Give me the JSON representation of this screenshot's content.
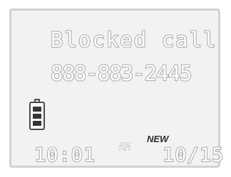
{
  "display": {
    "status_line": "Blocked call",
    "phone_number": "888-883-2445",
    "badge": "NEW",
    "time": "10:01",
    "am_pm": "AM",
    "date": "10/15"
  },
  "battery": {
    "level_bars": 3,
    "max_bars": 3,
    "icon": "battery-icon"
  },
  "colors": {
    "screen_bg": "#f2f2f2",
    "segment_outline": "#a9a9a9",
    "badge": "#2f2f2f"
  }
}
